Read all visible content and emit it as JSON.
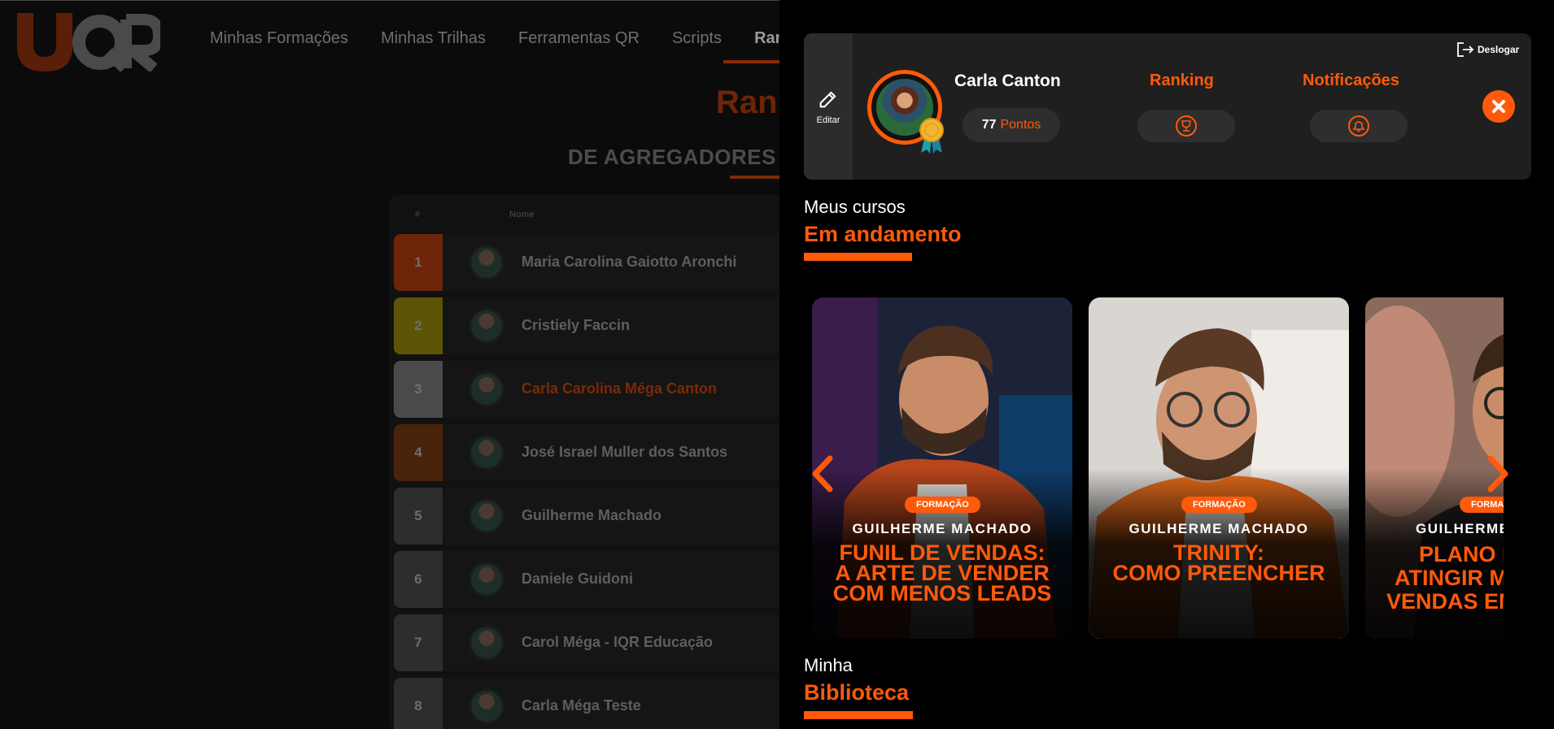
{
  "brand": {
    "logo_text": "IQR",
    "accent": "#ff5a0a"
  },
  "nav": {
    "items": [
      "Minhas Formações",
      "Minhas Trilhas",
      "Ferramentas QR",
      "Scripts",
      "Ranki"
    ],
    "active_index": 4
  },
  "ranking_page": {
    "title": "Ranki",
    "subtitle": "DE AGREGADORES I",
    "columns": {
      "rank": "#",
      "name": "Nome"
    },
    "rows": [
      {
        "rank": "1",
        "name": "Maria Carolina Gaiotto Aronchi",
        "color": "#6e2408"
      },
      {
        "rank": "2",
        "name": "Cristiely Faccin",
        "color": "#5d5408"
      },
      {
        "rank": "3",
        "name": "Carla Carolina Méga Canton",
        "color": "#4a4a4a",
        "highlight": true
      },
      {
        "rank": "4",
        "name": "José Israel Muller dos Santos",
        "color": "#4a230b"
      },
      {
        "rank": "5",
        "name": "Guilherme Machado",
        "color": "#2d2d2d"
      },
      {
        "rank": "6",
        "name": "Daniele Guidoni",
        "color": "#2d2d2d"
      },
      {
        "rank": "7",
        "name": "Carol Méga - IQR Educação",
        "color": "#2d2d2d"
      },
      {
        "rank": "8",
        "name": "Carla Méga Teste",
        "color": "#2d2d2d"
      }
    ]
  },
  "profile": {
    "edit_label": "Editar",
    "user_name": "Carla Canton",
    "points_value": "77",
    "points_label": "Pontos",
    "ranking_label": "Ranking",
    "notifications_label": "Notificações",
    "logout_label": "Deslogar",
    "trophy_icon": "trophy-icon",
    "bell_icon": "bell-icon"
  },
  "courses": {
    "section_small": "Meus cursos",
    "section_big": "Em andamento",
    "items": [
      {
        "tag": "FORMAÇÃO",
        "author": "GUILHERME MACHADO",
        "title_lines": [
          "FUNIL DE VENDAS:",
          "A ARTE DE VENDER",
          "COM MENOS LEADS"
        ]
      },
      {
        "tag": "FORMAÇÃO",
        "author": "GUILHERME MACHADO",
        "title_lines": [
          "TRINITY:",
          "COMO PREENCHER"
        ]
      },
      {
        "tag": "FORMA",
        "author": "GUILHERME",
        "title_lines": [
          "PLANO D",
          "ATINGIR M",
          "VENDAS EN"
        ]
      }
    ]
  },
  "library": {
    "section_small": "Minha",
    "section_big": "Biblioteca"
  }
}
